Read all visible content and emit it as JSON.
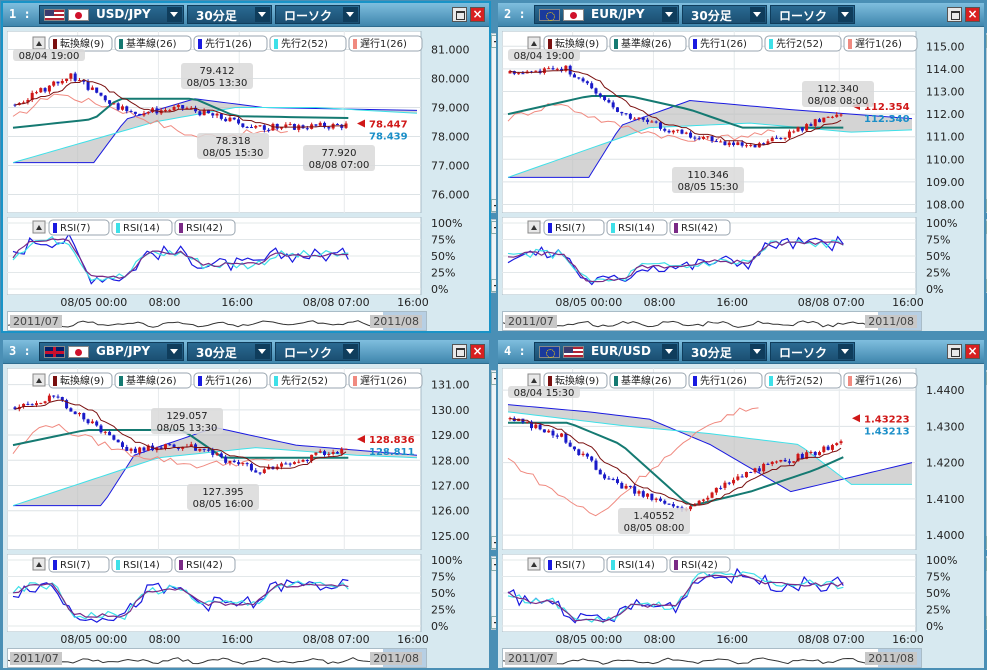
{
  "app": {
    "colors": {
      "accent": "#1993c7",
      "bg": "#4a8fb5",
      "bull": "#d01818",
      "bear": "#1a1ac8"
    }
  },
  "panels": [
    {
      "index": "1 :",
      "flag1": "us",
      "flag2": "jp",
      "pair": "USD/JPY",
      "timeframe": "30分足",
      "chart_type": "ローソク",
      "legend": [
        "転換線(9)",
        "基準線(26)",
        "先行1(26)",
        "先行2(52)",
        "遅行1(26)"
      ],
      "rsi_legend": [
        "RSI(7)",
        "RSI(14)",
        "RSI(42)"
      ],
      "time_labels": [
        "08/05 00:00",
        "08:00",
        "16:00",
        "08/08 07:00",
        "16:00"
      ],
      "nav_labels": [
        "2011/07",
        "2011/08"
      ],
      "price_labels": [
        "81.000",
        "80.000",
        "79.000",
        "78.000",
        "77.000",
        "76.000"
      ],
      "rsi_labels": [
        "100%",
        "75%",
        "50%",
        "25%",
        "0%"
      ],
      "ask": "78.447",
      "bid": "78.439",
      "annotations": [
        {
          "text1": "",
          "text2": "08/04 19:00"
        },
        {
          "text1": "79.412",
          "text2": "08/05 13:30"
        },
        {
          "text1": "78.318",
          "text2": "08/05 15:30"
        },
        {
          "text1": "77.920",
          "text2": "08/08 07:00"
        }
      ]
    },
    {
      "index": "2 :",
      "flag1": "eu",
      "flag2": "jp",
      "pair": "EUR/JPY",
      "timeframe": "30分足",
      "chart_type": "ローソク",
      "legend": [
        "転換線(9)",
        "基準線(26)",
        "先行1(26)",
        "先行2(52)",
        "遅行1(26)"
      ],
      "rsi_legend": [
        "RSI(7)",
        "RSI(14)",
        "RSI(42)"
      ],
      "time_labels": [
        "08/05 00:00",
        "08:00",
        "16:00",
        "08/08 07:00",
        "16:00"
      ],
      "nav_labels": [
        "2011/07",
        "2011/08"
      ],
      "price_labels": [
        "115.00",
        "114.00",
        "113.00",
        "112.00",
        "111.00",
        "110.00",
        "109.00",
        "108.00"
      ],
      "rsi_labels": [
        "100%",
        "75%",
        "50%",
        "25%",
        "0%"
      ],
      "ask": "112.354",
      "bid": "112.340",
      "annotations": [
        {
          "text1": "",
          "text2": "08/04 19:00"
        },
        {
          "text1": "112.340",
          "text2": "08/08 08:00"
        },
        {
          "text1": "110.346",
          "text2": "08/05 15:30"
        }
      ]
    },
    {
      "index": "3 :",
      "flag1": "uk",
      "flag2": "jp",
      "pair": "GBP/JPY",
      "timeframe": "30分足",
      "chart_type": "ローソク",
      "legend": [
        "転換線(9)",
        "基準線(26)",
        "先行1(26)",
        "先行2(52)",
        "遅行1(26)"
      ],
      "rsi_legend": [
        "RSI(7)",
        "RSI(14)",
        "RSI(42)"
      ],
      "time_labels": [
        "08/05 00:00",
        "08:00",
        "16:00",
        "08/08 07:00",
        "16:00"
      ],
      "nav_labels": [
        "2011/07",
        "2011/08"
      ],
      "price_labels": [
        "131.00",
        "130.00",
        "129.00",
        "128.00",
        "127.00",
        "126.00",
        "125.00"
      ],
      "rsi_labels": [
        "100%",
        "75%",
        "50%",
        "25%",
        "0%"
      ],
      "ask": "128.836",
      "bid": "128.811",
      "annotations": [
        {
          "text1": "129.057",
          "text2": "08/05 13:30"
        },
        {
          "text1": "127.395",
          "text2": "08/05 16:00"
        }
      ]
    },
    {
      "index": "4 :",
      "flag1": "eu",
      "flag2": "us",
      "pair": "EUR/USD",
      "timeframe": "30分足",
      "chart_type": "ローソク",
      "legend": [
        "転換線(9)",
        "基準線(26)",
        "先行1(26)",
        "先行2(52)",
        "遅行1(26)"
      ],
      "rsi_legend": [
        "RSI(7)",
        "RSI(14)",
        "RSI(42)"
      ],
      "time_labels": [
        "08/05 00:00",
        "08:00",
        "16:00",
        "08/08 07:00",
        "16:00"
      ],
      "nav_labels": [
        "2011/07",
        "2011/08"
      ],
      "price_labels": [
        "1.4400",
        "1.4300",
        "1.4200",
        "1.4100",
        "1.4000"
      ],
      "rsi_labels": [
        "100%",
        "75%",
        "50%",
        "25%",
        "0%"
      ],
      "ask": "1.43223",
      "bid": "1.43213",
      "annotations": [
        {
          "text1": "",
          "text2": "08/04 15:30"
        },
        {
          "text1": "1.40552",
          "text2": "08/05 08:00"
        }
      ]
    }
  ],
  "chart_data": [
    {
      "type": "line",
      "title": "USD/JPY",
      "ylim": [
        75.5,
        81.5
      ],
      "yticks": [
        81.0,
        80.0,
        79.0,
        78.0,
        77.0,
        76.0
      ],
      "x": [
        "08/05 00:00",
        "08:00",
        "16:00",
        "08/08 07:00",
        "16:00"
      ],
      "series": [
        {
          "name": "RSI(7)",
          "values": []
        },
        {
          "name": "RSI(14)",
          "values": []
        },
        {
          "name": "RSI(42)",
          "values": []
        }
      ],
      "spec": {
        "waypoints": [
          [
            0,
            79.1
          ],
          [
            0.14,
            80.1
          ],
          [
            0.28,
            78.8
          ],
          [
            0.42,
            79.0
          ],
          [
            0.6,
            78.3
          ],
          [
            0.82,
            78.4
          ],
          [
            1,
            78.44
          ]
        ],
        "cloudA": [
          [
            0,
            77.1
          ],
          [
            0.2,
            77.1
          ],
          [
            0.28,
            78.6
          ],
          [
            0.45,
            79.3
          ],
          [
            0.62,
            79.0
          ],
          [
            1,
            78.9
          ]
        ],
        "cloudB": [
          [
            0,
            77.1
          ],
          [
            0.35,
            78.5
          ],
          [
            0.55,
            79.0
          ],
          [
            0.75,
            79.0
          ],
          [
            1,
            78.8
          ]
        ],
        "kijun": [
          [
            0,
            78.3
          ],
          [
            0.2,
            78.6
          ],
          [
            0.26,
            79.3
          ],
          [
            0.45,
            79.3
          ],
          [
            0.55,
            78.7
          ],
          [
            1,
            78.6
          ]
        ],
        "chikou": [
          [
            0,
            78.6
          ],
          [
            0.1,
            79.5
          ],
          [
            0.25,
            79.0
          ],
          [
            0.45,
            78.0
          ],
          [
            0.68,
            78.2
          ]
        ]
      }
    },
    {
      "type": "line",
      "title": "EUR/JPY",
      "ylim": [
        107.8,
        115.5
      ],
      "yticks": [
        115.0,
        114.0,
        113.0,
        112.0,
        111.0,
        110.0,
        109.0,
        108.0
      ],
      "x": [
        "08/05 00:00",
        "08:00",
        "16:00",
        "08/08 07:00",
        "16:00"
      ],
      "series": [
        {
          "name": "RSI(7)",
          "values": []
        },
        {
          "name": "RSI(14)",
          "values": []
        },
        {
          "name": "RSI(42)",
          "values": []
        }
      ],
      "spec": {
        "waypoints": [
          [
            0,
            113.8
          ],
          [
            0.14,
            114.0
          ],
          [
            0.28,
            112.0
          ],
          [
            0.45,
            111.0
          ],
          [
            0.6,
            110.5
          ],
          [
            0.82,
            112.1
          ],
          [
            1,
            112.35
          ]
        ],
        "cloudA": [
          [
            0,
            109.2
          ],
          [
            0.2,
            109.2
          ],
          [
            0.28,
            111.5
          ],
          [
            0.45,
            112.6
          ],
          [
            0.7,
            112.2
          ],
          [
            1,
            111.8
          ]
        ],
        "cloudB": [
          [
            0,
            109.2
          ],
          [
            0.35,
            111.4
          ],
          [
            0.6,
            111.6
          ],
          [
            0.85,
            111.2
          ],
          [
            1,
            111.3
          ]
        ],
        "kijun": [
          [
            0,
            112.0
          ],
          [
            0.2,
            112.8
          ],
          [
            0.3,
            112.8
          ],
          [
            0.45,
            112.2
          ],
          [
            0.58,
            111.4
          ],
          [
            1,
            111.4
          ]
        ],
        "chikou": [
          [
            0,
            111.8
          ],
          [
            0.12,
            112.5
          ],
          [
            0.25,
            111.6
          ],
          [
            0.45,
            110.8
          ],
          [
            0.66,
            111.2
          ]
        ]
      }
    },
    {
      "type": "line",
      "title": "GBP/JPY",
      "ylim": [
        124.6,
        131.5
      ],
      "yticks": [
        131.0,
        130.0,
        129.0,
        128.0,
        127.0,
        126.0,
        125.0
      ],
      "x": [
        "08/05 00:00",
        "08:00",
        "16:00",
        "08/08 07:00",
        "16:00"
      ],
      "series": [
        {
          "name": "RSI(7)",
          "values": []
        },
        {
          "name": "RSI(14)",
          "values": []
        },
        {
          "name": "RSI(42)",
          "values": []
        }
      ],
      "spec": {
        "waypoints": [
          [
            0,
            130.1
          ],
          [
            0.1,
            130.5
          ],
          [
            0.28,
            128.4
          ],
          [
            0.42,
            128.6
          ],
          [
            0.6,
            127.6
          ],
          [
            0.8,
            128.4
          ],
          [
            1,
            128.82
          ]
        ],
        "cloudA": [
          [
            0,
            126.2
          ],
          [
            0.22,
            126.2
          ],
          [
            0.3,
            128.2
          ],
          [
            0.5,
            129.3
          ],
          [
            0.7,
            128.6
          ],
          [
            1,
            128.2
          ]
        ],
        "cloudB": [
          [
            0,
            126.2
          ],
          [
            0.36,
            128.1
          ],
          [
            0.6,
            128.5
          ],
          [
            0.85,
            128.2
          ],
          [
            1,
            128.1
          ]
        ],
        "kijun": [
          [
            0,
            128.6
          ],
          [
            0.18,
            129.2
          ],
          [
            0.42,
            129.2
          ],
          [
            0.52,
            128.1
          ],
          [
            1,
            128.1
          ]
        ],
        "chikou": [
          [
            0,
            128.3
          ],
          [
            0.08,
            129.5
          ],
          [
            0.28,
            128.3
          ],
          [
            0.45,
            127.8
          ],
          [
            0.65,
            128.0
          ]
        ]
      }
    },
    {
      "type": "line",
      "title": "EUR/USD",
      "ylim": [
        1.397,
        1.445
      ],
      "yticks": [
        1.44,
        1.43,
        1.42,
        1.41,
        1.4
      ],
      "x": [
        "08/05 00:00",
        "08:00",
        "16:00",
        "08/08 07:00",
        "16:00"
      ],
      "series": [
        {
          "name": "RSI(7)",
          "values": []
        },
        {
          "name": "RSI(14)",
          "values": []
        },
        {
          "name": "RSI(42)",
          "values": []
        }
      ],
      "spec": {
        "waypoints": [
          [
            0,
            1.432
          ],
          [
            0.12,
            1.428
          ],
          [
            0.25,
            1.415
          ],
          [
            0.42,
            1.407
          ],
          [
            0.6,
            1.418
          ],
          [
            0.82,
            1.425
          ],
          [
            1,
            1.4322
          ]
        ],
        "cloudA": [
          [
            0,
            1.436
          ],
          [
            0.2,
            1.434
          ],
          [
            0.35,
            1.432
          ],
          [
            0.5,
            1.425
          ],
          [
            0.7,
            1.412
          ],
          [
            1,
            1.42
          ]
        ],
        "cloudB": [
          [
            0,
            1.434
          ],
          [
            0.3,
            1.43
          ],
          [
            0.5,
            1.428
          ],
          [
            0.72,
            1.425
          ],
          [
            0.85,
            1.414
          ],
          [
            1,
            1.414
          ]
        ],
        "kijun": [
          [
            0,
            1.431
          ],
          [
            0.15,
            1.431
          ],
          [
            0.28,
            1.425
          ],
          [
            0.45,
            1.408
          ],
          [
            0.6,
            1.412
          ],
          [
            0.76,
            1.418
          ],
          [
            0.88,
            1.424
          ],
          [
            1,
            1.424
          ]
        ],
        "chikou": [
          [
            0,
            1.421
          ],
          [
            0.1,
            1.413
          ],
          [
            0.22,
            1.405
          ],
          [
            0.35,
            1.418
          ],
          [
            0.52,
            1.432
          ],
          [
            0.62,
            1.436
          ]
        ]
      }
    }
  ]
}
